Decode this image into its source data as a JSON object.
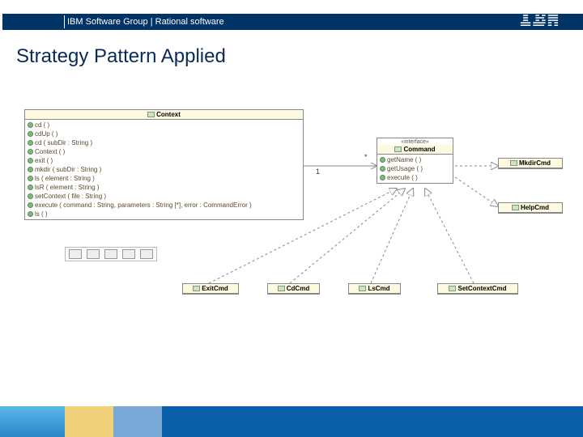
{
  "header": {
    "text": "IBM Software Group | Rational software",
    "logo": "IBM"
  },
  "title": "Strategy Pattern Applied",
  "context": {
    "name": "Context",
    "ops": [
      "cd ( )",
      "cdUp ( )",
      "cd ( subDir : String )",
      "Context ( )",
      "exit ( )",
      "mkdir ( subDir : String )",
      "ls ( element : String )",
      "lsR ( element : String )",
      "setContext ( file : String )",
      "execute ( command : String, parameters : String [*], error : CommandError )",
      "ls ( )"
    ]
  },
  "command": {
    "stereotype": "«interface»",
    "name": "Command",
    "ops": [
      "getName ( )",
      "getUsage ( )",
      "execute ( )"
    ]
  },
  "impls": {
    "mkdir": "MkdirCmd",
    "help": "HelpCmd",
    "exit": "ExitCmd",
    "cd": "CdCmd",
    "ls": "LsCmd",
    "set": "SetContextCmd"
  },
  "mult": {
    "one": "1",
    "star": "*"
  }
}
